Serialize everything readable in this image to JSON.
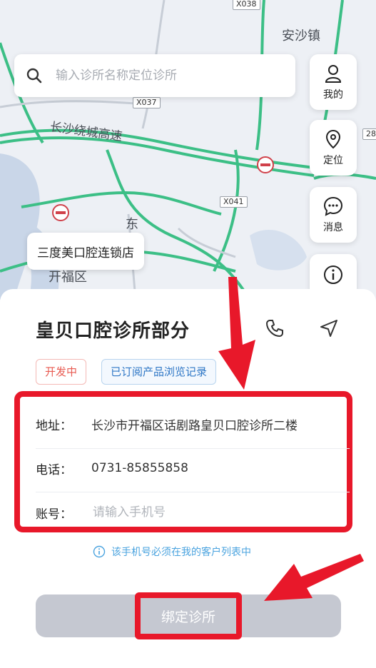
{
  "map": {
    "labels": {
      "anshazhen": "安沙镇",
      "ring_expressway": "长沙绕城高速",
      "dong": "东",
      "kaifu": "开福区"
    },
    "road_tags": [
      "X038",
      "X037",
      "X041",
      "28"
    ]
  },
  "search": {
    "placeholder": "输入诊所名称定位诊所"
  },
  "side_buttons": {
    "mine": "我的",
    "locate": "定位",
    "messages": "消息"
  },
  "callout": "三度美口腔连锁店",
  "sheet": {
    "clinic_name": "皇贝口腔诊所部分",
    "tags": {
      "status": "开发中",
      "subscribed": "已订阅产品浏览记录"
    },
    "rows": {
      "address_label": "地址：",
      "address_value": "长沙市开福区话剧路皇贝口腔诊所二楼",
      "phone_label": "电话：",
      "phone_value": "0731-85855858",
      "account_label": "账号：",
      "account_placeholder": "请输入手机号"
    },
    "hint": "该手机号必须在我的客户列表中",
    "bind_button": "绑定诊所"
  },
  "colors": {
    "highlight": "#e8182a",
    "road": "#3cbf86",
    "accent_blue": "#2f77c6"
  }
}
